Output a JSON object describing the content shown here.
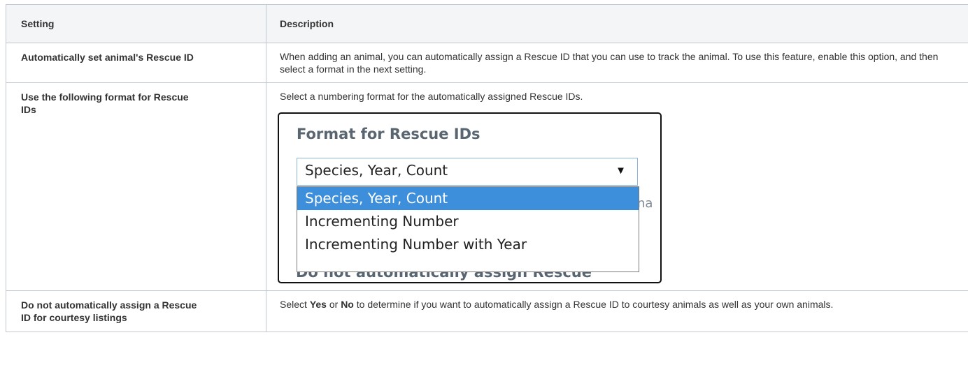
{
  "table": {
    "headers": [
      "Setting",
      "Description"
    ],
    "rows": [
      {
        "setting": "Automatically set animal's Rescue ID",
        "description": "When adding an animal, you can automatically assign a Rescue ID that you can use to track the animal. To use this feature, enable this option, and then select a format in the next setting."
      },
      {
        "setting": "Use the following format for Rescue IDs",
        "description": "Select a numbering format for the automatically assigned Rescue IDs."
      },
      {
        "setting": "Do not automatically assign a Rescue ID for courtesy listings",
        "description_parts": [
          "Select ",
          "Yes",
          " or ",
          "No",
          " to determine if you want to automatically assign a Rescue ID to courtesy animals as well as your own animals."
        ]
      }
    ]
  },
  "screenshot": {
    "heading": "Format for Rescue IDs",
    "selected_value": "Species, Year, Count",
    "arrow_icon": "triangle-down-icon",
    "options": [
      "Species, Year, Count",
      "Incrementing Number",
      "Incrementing Number with Year"
    ],
    "selected_color": "#3d8fdb",
    "behind_fragment": "na",
    "behind_heading": "Do not automatically assign Rescue"
  }
}
